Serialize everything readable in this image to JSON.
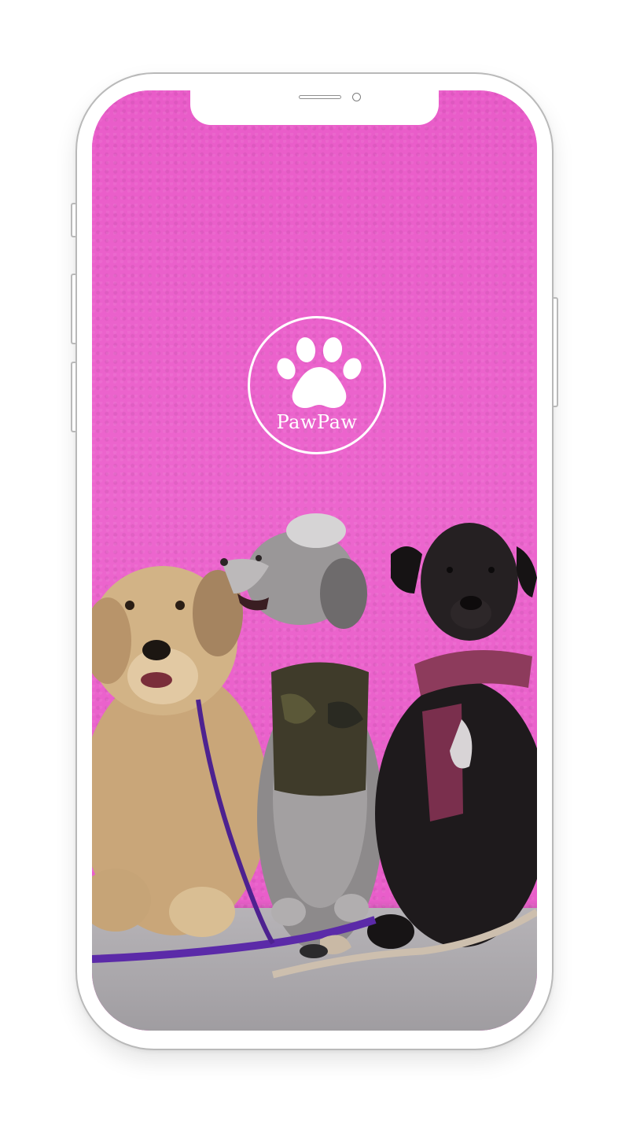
{
  "app": {
    "brand_name": "PawPaw",
    "logo_icon": "paw-icon"
  },
  "colors": {
    "background_wall": "#ea5fcb",
    "logo_foreground": "#ffffff",
    "frame_stroke": "#b9b9b9"
  }
}
